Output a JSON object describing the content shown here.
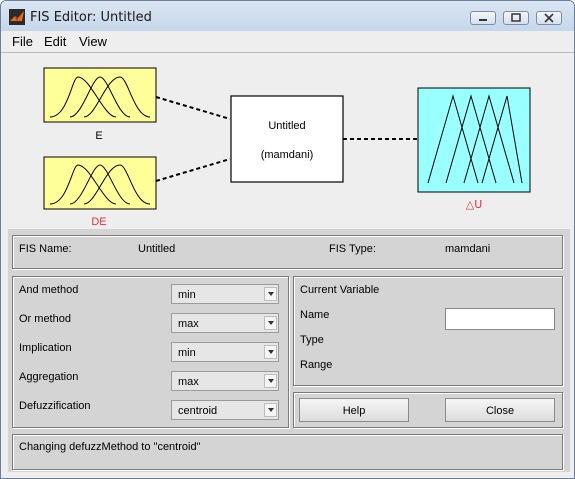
{
  "window": {
    "title": "FIS Editor: Untitled"
  },
  "menu": [
    "File",
    "Edit",
    "View"
  ],
  "diagram": {
    "inputs": [
      {
        "name": "E",
        "color": "#000000"
      },
      {
        "name": "DE",
        "color": "#e0343c"
      }
    ],
    "system": {
      "name": "Untitled",
      "type": "(mamdani)"
    },
    "output": {
      "name": "△U",
      "color": "#e0343c"
    },
    "input_block_color": "#ffff99",
    "output_block_color": "#99ffff"
  },
  "fis_info": {
    "name_label": "FIS Name:",
    "name_value": "Untitled",
    "type_label": "FIS Type:",
    "type_value": "mamdani"
  },
  "methods": [
    {
      "label": "And method",
      "value": "min"
    },
    {
      "label": "Or method",
      "value": "max"
    },
    {
      "label": "Implication",
      "value": "min"
    },
    {
      "label": "Aggregation",
      "value": "max"
    },
    {
      "label": "Defuzzification",
      "value": "centroid"
    }
  ],
  "current_variable": {
    "title": "Current Variable",
    "name_label": "Name",
    "name_value": "",
    "type_label": "Type",
    "type_value": "",
    "range_label": "Range",
    "range_value": ""
  },
  "buttons": {
    "help": "Help",
    "close": "Close"
  },
  "status": "Changing defuzzMethod to \"centroid\""
}
